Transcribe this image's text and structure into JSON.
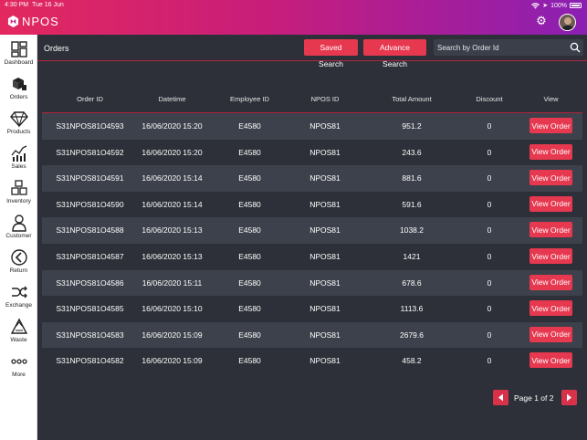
{
  "status_bar": {
    "time": "4:30 PM",
    "date": "Tue 16 Jun",
    "battery": "100%"
  },
  "app": {
    "logo_text": "NPOS"
  },
  "sidebar": {
    "items": [
      {
        "label": "Dashboard",
        "icon": "dashboard-icon"
      },
      {
        "label": "Orders",
        "icon": "orders-icon"
      },
      {
        "label": "Products",
        "icon": "diamond-icon"
      },
      {
        "label": "Sales",
        "icon": "sales-chart-icon"
      },
      {
        "label": "Inventory",
        "icon": "boxes-icon"
      },
      {
        "label": "Customer",
        "icon": "person-icon"
      },
      {
        "label": "Return",
        "icon": "return-icon"
      },
      {
        "label": "Exchange",
        "icon": "exchange-icon"
      },
      {
        "label": "Waste",
        "icon": "recycle-icon"
      },
      {
        "label": "More",
        "icon": "more-dots-icon"
      }
    ]
  },
  "header": {
    "title": "Orders",
    "saved_search_label": "Saved Search",
    "advance_search_label": "Advance Search",
    "search_placeholder": "Search by Order Id"
  },
  "table": {
    "columns": [
      "Order ID",
      "Datetime",
      "Employee ID",
      "NPOS ID",
      "Total Amount",
      "Discount",
      "View"
    ],
    "view_button_label": "View Order",
    "rows": [
      {
        "order_id": "S31NPOS81O4593",
        "datetime": "16/06/2020 15:20",
        "employee_id": "E4580",
        "npos_id": "NPOS81",
        "total": "951.2",
        "discount": "0"
      },
      {
        "order_id": "S31NPOS81O4592",
        "datetime": "16/06/2020 15:20",
        "employee_id": "E4580",
        "npos_id": "NPOS81",
        "total": "243.6",
        "discount": "0"
      },
      {
        "order_id": "S31NPOS81O4591",
        "datetime": "16/06/2020 15:14",
        "employee_id": "E4580",
        "npos_id": "NPOS81",
        "total": "881.6",
        "discount": "0"
      },
      {
        "order_id": "S31NPOS81O4590",
        "datetime": "16/06/2020 15:14",
        "employee_id": "E4580",
        "npos_id": "NPOS81",
        "total": "591.6",
        "discount": "0"
      },
      {
        "order_id": "S31NPOS81O4588",
        "datetime": "16/06/2020 15:13",
        "employee_id": "E4580",
        "npos_id": "NPOS81",
        "total": "1038.2",
        "discount": "0"
      },
      {
        "order_id": "S31NPOS81O4587",
        "datetime": "16/06/2020 15:13",
        "employee_id": "E4580",
        "npos_id": "NPOS81",
        "total": "1421",
        "discount": "0"
      },
      {
        "order_id": "S31NPOS81O4586",
        "datetime": "16/06/2020 15:11",
        "employee_id": "E4580",
        "npos_id": "NPOS81",
        "total": "678.6",
        "discount": "0"
      },
      {
        "order_id": "S31NPOS81O4585",
        "datetime": "16/06/2020 15:10",
        "employee_id": "E4580",
        "npos_id": "NPOS81",
        "total": "1113.6",
        "discount": "0"
      },
      {
        "order_id": "S31NPOS81O4583",
        "datetime": "16/06/2020 15:09",
        "employee_id": "E4580",
        "npos_id": "NPOS81",
        "total": "2679.6",
        "discount": "0"
      },
      {
        "order_id": "S31NPOS81O4582",
        "datetime": "16/06/2020 15:09",
        "employee_id": "E4580",
        "npos_id": "NPOS81",
        "total": "458.2",
        "discount": "0"
      }
    ]
  },
  "pagination": {
    "text": "Page 1 of 2"
  },
  "colors": {
    "accent": "#e6384f",
    "background": "#2d3038",
    "row_alt": "#3d414b",
    "gradient_start": "#e2285e",
    "gradient_end": "#8a1fb3"
  }
}
